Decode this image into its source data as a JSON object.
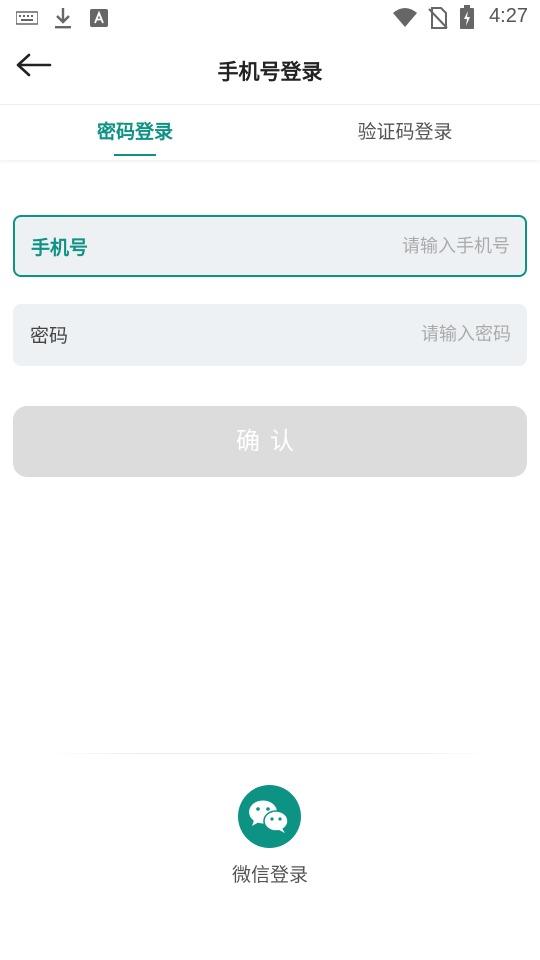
{
  "status_bar": {
    "time": "4:27",
    "left_icons": [
      "keyboard-icon",
      "download-icon",
      "text-a-icon"
    ],
    "right_icons": [
      "wifi-icon",
      "no-sim-icon",
      "battery-charging-icon"
    ]
  },
  "app_bar": {
    "title": "手机号登录",
    "back_icon": "arrow-left-icon"
  },
  "tabs": [
    {
      "label": "密码登录",
      "active": true
    },
    {
      "label": "验证码登录",
      "active": false
    }
  ],
  "form": {
    "phone": {
      "label": "手机号",
      "placeholder": "请输入手机号",
      "value": ""
    },
    "password": {
      "label": "密码",
      "placeholder": "请输入密码",
      "value": ""
    }
  },
  "confirm_button": {
    "label": "确认"
  },
  "wechat_login": {
    "label": "微信登录",
    "icon": "wechat-icon"
  },
  "colors": {
    "accent": "#0d9384",
    "field_background": "#eef1f4",
    "button_disabled": "#dcdcdc"
  }
}
